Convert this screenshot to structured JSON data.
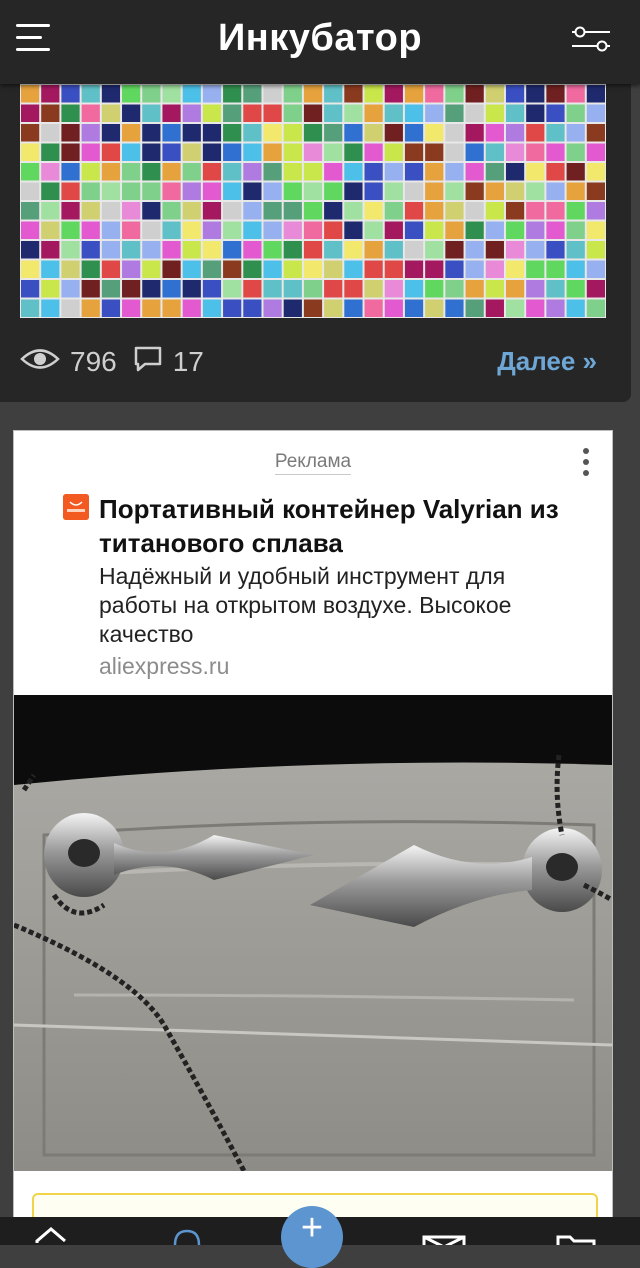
{
  "header": {
    "title": "Инкубатор",
    "menu_icon": "hamburger-menu-icon",
    "filter_icon": "filter-sliders-icon"
  },
  "post": {
    "views": "796",
    "comments": "17",
    "more_label": "Далее »"
  },
  "ad": {
    "label": "Реклама",
    "logo_text": "AliExpress",
    "title": "Портативный контейнер Valyrian из титанового сплава",
    "description": "Надёжный и удобный инструмент для работы на открытом воздухе. Высокое качество",
    "domain": "aliexpress.ru"
  },
  "bottom_nav": {
    "items": [
      "home-icon",
      "bell-icon",
      "add-icon",
      "mail-icon",
      "folder-icon"
    ],
    "fab_label": "+"
  },
  "colors": {
    "bar_bg": "#262626",
    "page_bg": "#3f3f3f",
    "accent_link": "#6ea6d6",
    "fab": "#5c95cf"
  }
}
